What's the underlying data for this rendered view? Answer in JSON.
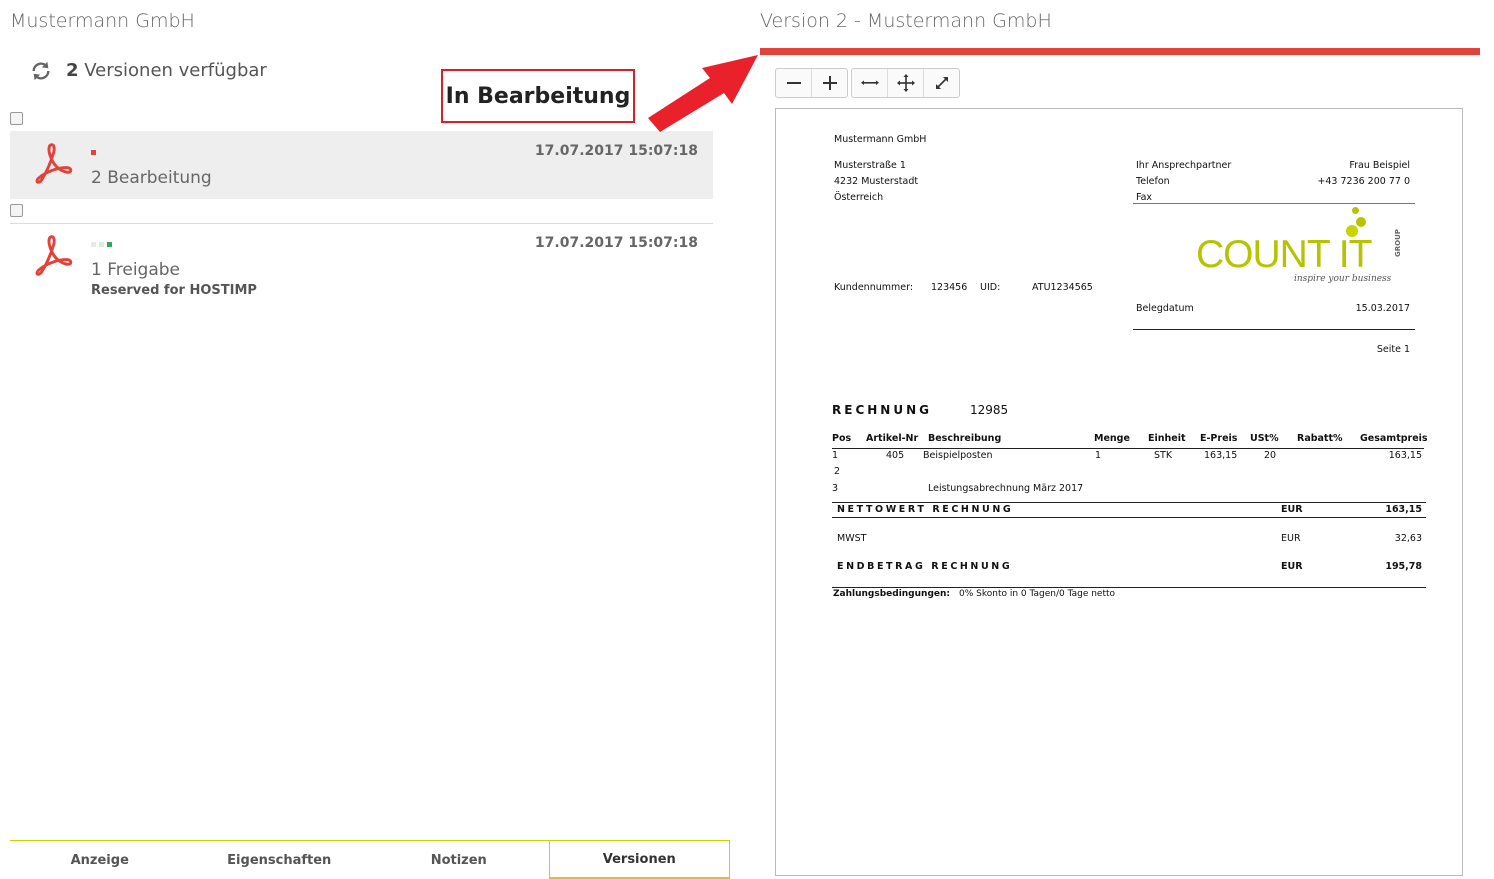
{
  "left": {
    "title": "Mustermann GmbH",
    "versions_count": "2",
    "versions_text": " Versionen verfügbar",
    "items": [
      {
        "label": "2 Bearbeitung",
        "date": "17.07.2017 15:07:18",
        "sub": ""
      },
      {
        "label": "1 Freigabe",
        "date": "17.07.2017 15:07:18",
        "sub": "Reserved for HOSTIMP"
      }
    ]
  },
  "annotation": {
    "text": "In Bearbeitung",
    "color": "#d9202a"
  },
  "tabs": [
    {
      "label": "Anzeige"
    },
    {
      "label": "Eigenschaften"
    },
    {
      "label": "Notizen"
    },
    {
      "label": "Versionen"
    }
  ],
  "right": {
    "title": "Version 2 - Mustermann GmbH",
    "accent_color": "#e2423a"
  },
  "toolbar": {
    "buttons": [
      "minus-icon",
      "plus-icon",
      "fit-width-icon",
      "move-icon",
      "expand-icon"
    ]
  },
  "document": {
    "company": "Mustermann GmbH",
    "street": "Musterstraße 1",
    "city": "4232 Musterstadt",
    "country": "Österreich",
    "contact_label": "Ihr Ansprechpartner",
    "contact_value": "Frau Beispiel",
    "phone_label": "Telefon",
    "phone_value": "+43 7236 200 77 0",
    "fax_label": "Fax",
    "logo_main": "COUNT IT",
    "logo_group": "GROUP",
    "logo_tagline": "inspire your business",
    "customer_label": "Kundennummer:",
    "customer_value": "123456",
    "uid_label": "UID:",
    "uid_value": "ATU1234565",
    "date_label": "Belegdatum",
    "date_value": "15.03.2017",
    "page_label": "Seite 1",
    "invoice_label": "RECHNUNG",
    "invoice_number": "12985",
    "columns": [
      "Pos",
      "Artikel-Nr",
      "Beschreibung",
      "Menge",
      "Einheit",
      "E-Preis",
      "USt%",
      "Rabatt%",
      "Gesamtpreis"
    ],
    "rows": [
      {
        "pos": "1",
        "art": "405",
        "desc": "Beispielposten",
        "qty": "1",
        "unit": "STK",
        "price": "163,15",
        "vat": "20",
        "total": "163,15"
      },
      {
        "pos": "2",
        "art": "",
        "desc": "",
        "qty": "",
        "unit": "",
        "price": "",
        "vat": "",
        "total": ""
      },
      {
        "pos": "3",
        "art": "",
        "desc": "Leistungsabrechnung März 2017",
        "qty": "",
        "unit": "",
        "price": "",
        "vat": "",
        "total": ""
      }
    ],
    "net_label": "NETTOWERT RECHNUNG",
    "net_cur": "EUR",
    "net_value": "163,15",
    "vat_label": "MWST",
    "vat_cur": "EUR",
    "vat_value": "32,63",
    "total_label": "ENDBETRAG RECHNUNG",
    "total_cur": "EUR",
    "total_value": "195,78",
    "terms_label": "Zahlungsbedingungen:",
    "terms_value": "0% Skonto in 0 Tagen/0 Tage netto"
  }
}
